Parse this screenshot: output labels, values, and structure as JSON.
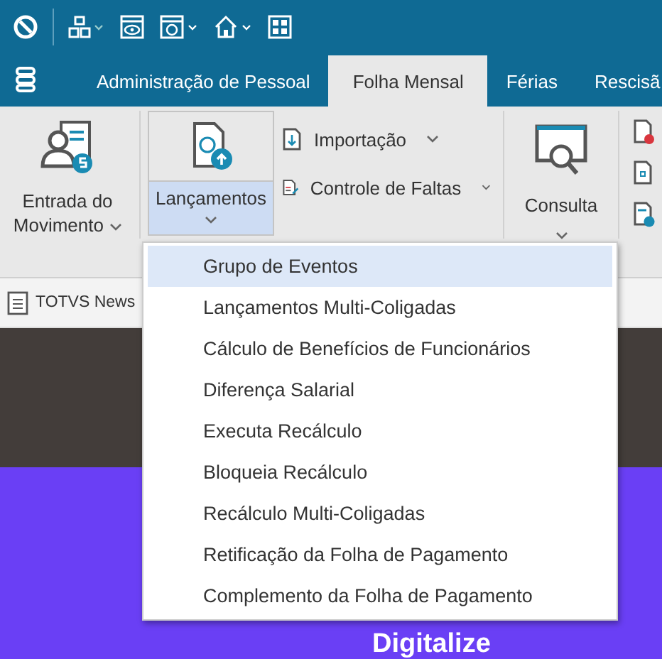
{
  "tabs": [
    {
      "label": "Administração de Pessoal",
      "selected": false
    },
    {
      "label": "Folha Mensal",
      "selected": true
    },
    {
      "label": "Férias",
      "selected": false
    },
    {
      "label": "Rescisã",
      "selected": false
    }
  ],
  "ribbon": {
    "entrada": {
      "label": "Entrada do Movimento"
    },
    "lancamentos": {
      "label": "Lançamentos",
      "expanded": true
    },
    "small_buttons": [
      {
        "label": "Importação"
      },
      {
        "label": "Controle de Faltas"
      }
    ],
    "consulta": {
      "label": "Consulta"
    }
  },
  "document_tabs": [
    {
      "label": "TOTVS News"
    }
  ],
  "menu": [
    {
      "label": "Grupo de Eventos",
      "selected": true
    },
    {
      "label": "Lançamentos Multi-Coligadas",
      "selected": false
    },
    {
      "label": "Cálculo de Benefícios de Funcionários",
      "selected": false
    },
    {
      "label": "Diferença Salarial",
      "selected": false
    },
    {
      "label": "Executa Recálculo",
      "selected": false
    },
    {
      "label": "Bloqueia Recálculo",
      "selected": false
    },
    {
      "label": "Recálculo Multi-Coligadas",
      "selected": false
    },
    {
      "label": "Retificação da Folha de Pagamento",
      "selected": false
    },
    {
      "label": "Complemento da Folha de Pagamento",
      "selected": false
    }
  ],
  "banner": {
    "headline": "Digitalize"
  }
}
